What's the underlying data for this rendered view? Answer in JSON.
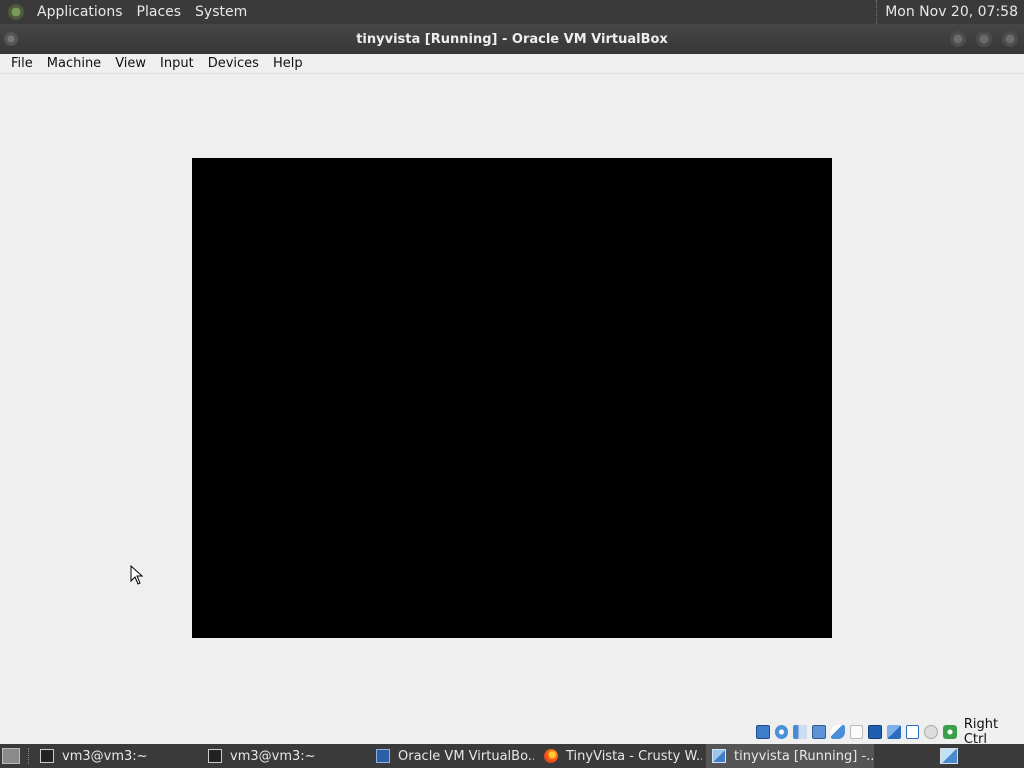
{
  "top_panel": {
    "menus": [
      "Applications",
      "Places",
      "System"
    ],
    "clock": "Mon Nov 20, 07:58"
  },
  "window": {
    "title": "tinyvista [Running] - Oracle VM VirtualBox"
  },
  "menubar": {
    "items": [
      "File",
      "Machine",
      "View",
      "Input",
      "Devices",
      "Help"
    ]
  },
  "statusbar": {
    "host_key": "Right Ctrl",
    "icons": [
      "hard-disk-icon",
      "optical-drive-icon",
      "audio-icon",
      "network-icon",
      "usb-icon",
      "shared-folders-icon",
      "display-icon",
      "recording-icon",
      "capture-icon",
      "mouse-integration-icon",
      "keyboard-icon"
    ]
  },
  "taskbar": {
    "tasks": [
      {
        "label": "vm3@vm3:~",
        "icon": "terminal-icon"
      },
      {
        "label": "vm3@vm3:~",
        "icon": "terminal-icon"
      },
      {
        "label": "Oracle VM VirtualBo...",
        "icon": "virtualbox-icon"
      },
      {
        "label": "TinyVista - Crusty W...",
        "icon": "firefox-icon"
      },
      {
        "label": "tinyvista [Running] -...",
        "icon": "vm-window-icon",
        "active": true
      }
    ]
  }
}
